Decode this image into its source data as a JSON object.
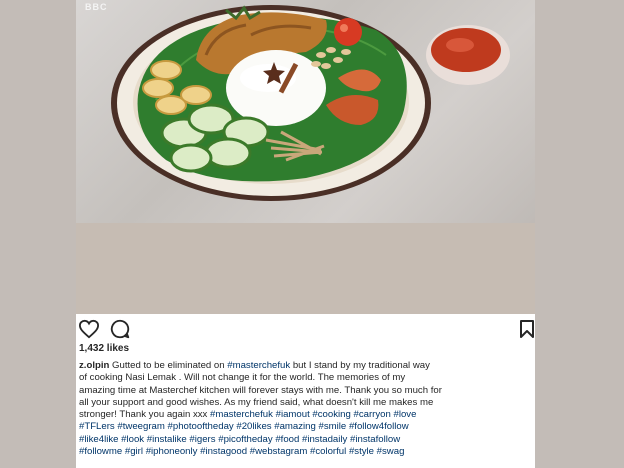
{
  "photo": {
    "watermark": "BBC",
    "alt": "Nasi Lemak plate on banana leaf with rice, cucumber, anchovies, prawns, peanuts, egg rolls and sambal"
  },
  "post": {
    "likes": "1,432 likes",
    "username": "z.olpin",
    "caption_lines": [
      [
        {
          "t": "z.olpin",
          "k": "user"
        },
        {
          "t": " Gutted to be eliminated on ",
          "k": "text"
        },
        {
          "t": "#masterchefuk",
          "k": "tag"
        },
        {
          "t": " but I stand by my traditional way",
          "k": "text"
        }
      ],
      [
        {
          "t": "of cooking Nasi Lemak . Will not change it for the world. The memories of my",
          "k": "text"
        }
      ],
      [
        {
          "t": "amazing time at Masterchef kitchen will forever stays with me. Thank you so much for",
          "k": "text"
        }
      ],
      [
        {
          "t": "all your support and good wishes. As my friend said, what doesn't kill me makes me",
          "k": "text"
        }
      ],
      [
        {
          "t": "stronger! Thank you again xxx ",
          "k": "text"
        },
        {
          "t": "#masterchefuk",
          "k": "tag"
        },
        {
          "t": " ",
          "k": "text"
        },
        {
          "t": "#iamout",
          "k": "tag"
        },
        {
          "t": " ",
          "k": "text"
        },
        {
          "t": "#cooking",
          "k": "tag"
        },
        {
          "t": " ",
          "k": "text"
        },
        {
          "t": "#carryon",
          "k": "tag"
        },
        {
          "t": " ",
          "k": "text"
        },
        {
          "t": "#love",
          "k": "tag"
        }
      ],
      [
        {
          "t": "#TFLers",
          "k": "tag"
        },
        {
          "t": " ",
          "k": "text"
        },
        {
          "t": "#tweegram",
          "k": "tag"
        },
        {
          "t": " ",
          "k": "text"
        },
        {
          "t": "#photooftheday",
          "k": "tag"
        },
        {
          "t": " ",
          "k": "text"
        },
        {
          "t": "#20likes",
          "k": "tag"
        },
        {
          "t": " ",
          "k": "text"
        },
        {
          "t": "#amazing",
          "k": "tag"
        },
        {
          "t": " ",
          "k": "text"
        },
        {
          "t": "#smile",
          "k": "tag"
        },
        {
          "t": " ",
          "k": "text"
        },
        {
          "t": "#follow4follow",
          "k": "tag"
        }
      ],
      [
        {
          "t": "#like4like",
          "k": "tag"
        },
        {
          "t": " ",
          "k": "text"
        },
        {
          "t": "#look",
          "k": "tag"
        },
        {
          "t": " ",
          "k": "text"
        },
        {
          "t": "#instalike",
          "k": "tag"
        },
        {
          "t": " ",
          "k": "text"
        },
        {
          "t": "#igers",
          "k": "tag"
        },
        {
          "t": " ",
          "k": "text"
        },
        {
          "t": "#picoftheday",
          "k": "tag"
        },
        {
          "t": " ",
          "k": "text"
        },
        {
          "t": "#food",
          "k": "tag"
        },
        {
          "t": " ",
          "k": "text"
        },
        {
          "t": "#instadaily",
          "k": "tag"
        },
        {
          "t": " ",
          "k": "text"
        },
        {
          "t": "#instafollow",
          "k": "tag"
        }
      ],
      [
        {
          "t": "#followme",
          "k": "tag"
        },
        {
          "t": " ",
          "k": "text"
        },
        {
          "t": "#girl",
          "k": "tag"
        },
        {
          "t": " ",
          "k": "text"
        },
        {
          "t": "#iphoneonly",
          "k": "tag"
        },
        {
          "t": " ",
          "k": "text"
        },
        {
          "t": "#instagood",
          "k": "tag"
        },
        {
          "t": " ",
          "k": "text"
        },
        {
          "t": "#webstagram",
          "k": "tag"
        },
        {
          "t": " ",
          "k": "text"
        },
        {
          "t": "#colorful",
          "k": "tag"
        },
        {
          "t": " ",
          "k": "text"
        },
        {
          "t": "#style",
          "k": "tag"
        },
        {
          "t": " ",
          "k": "text"
        },
        {
          "t": "#swag",
          "k": "tag"
        }
      ]
    ]
  },
  "icons": {
    "like": "heart-icon",
    "comment": "comment-bubble-icon",
    "save": "bookmark-icon"
  },
  "colors": {
    "hashtag": "#003569",
    "text": "#262626",
    "page_background": "#c3bcb7",
    "divider_band": "#c6bcb3"
  }
}
